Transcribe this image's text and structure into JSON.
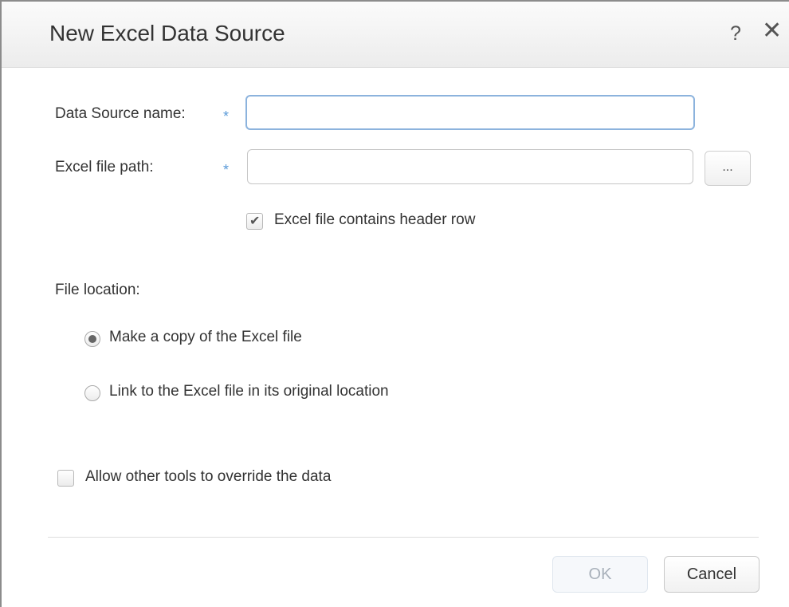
{
  "dialog": {
    "title": "New Excel Data Source",
    "help_symbol": "?",
    "close_symbol": "✕"
  },
  "form": {
    "data_source_name": {
      "label": "Data Source name:",
      "required_marker": "*",
      "value": "",
      "placeholder": ""
    },
    "excel_file_path": {
      "label": "Excel file path:",
      "required_marker": "*",
      "value": "",
      "placeholder": "",
      "browse_label": "..."
    },
    "header_row": {
      "label": "Excel file contains header row",
      "checked": true
    },
    "file_location": {
      "label": "File location:",
      "options": [
        {
          "label": "Make a copy of the Excel file",
          "selected": true
        },
        {
          "label": "Link to the Excel file in its original location",
          "selected": false
        }
      ]
    },
    "allow_override": {
      "label": "Allow other tools to override the data",
      "checked": false
    }
  },
  "buttons": {
    "ok_label": "OK",
    "ok_enabled": false,
    "cancel_label": "Cancel"
  },
  "colors": {
    "required_star": "#5a9ad8",
    "focus_border": "#8cb3dd",
    "disabled_text": "#a8b0ba"
  }
}
